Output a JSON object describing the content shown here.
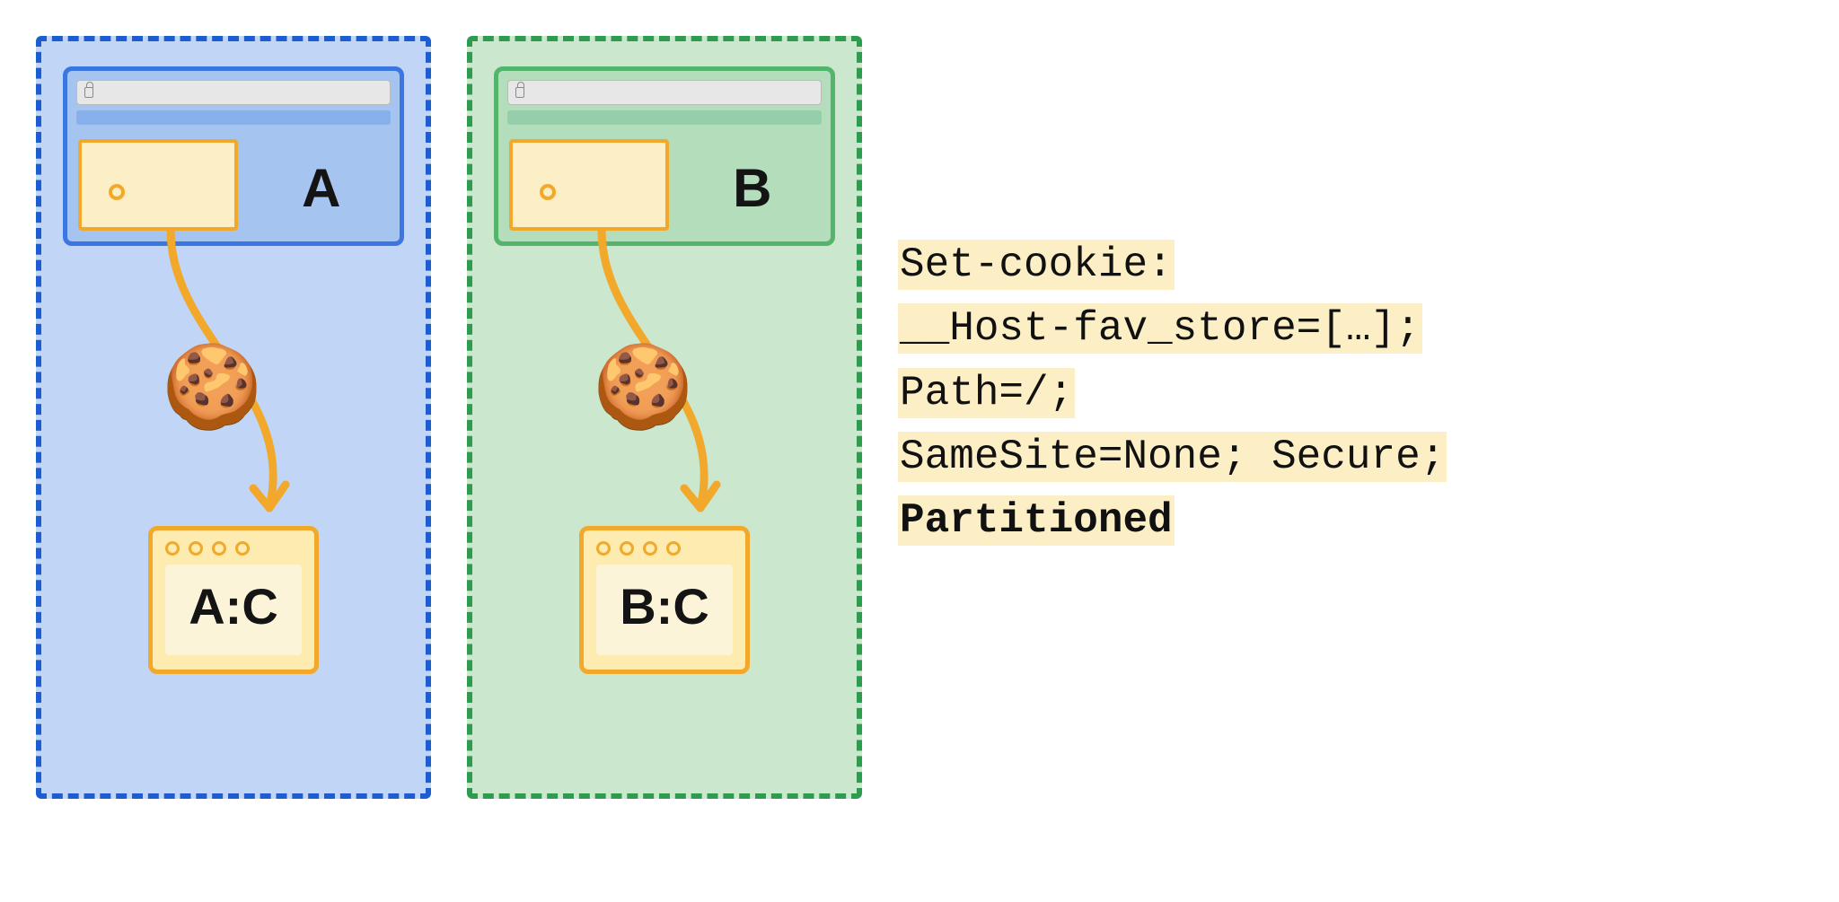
{
  "partitions": [
    {
      "site_label": "A",
      "jar_label": "A:C",
      "color": "blue"
    },
    {
      "site_label": "B",
      "jar_label": "B:C",
      "color": "green"
    }
  ],
  "cookie_header": {
    "line1": "Set-cookie:",
    "line2": "__Host-fav_store=[…];",
    "line3": "Path=/;",
    "line4": "SameSite=None; Secure;",
    "line5": "Partitioned"
  }
}
